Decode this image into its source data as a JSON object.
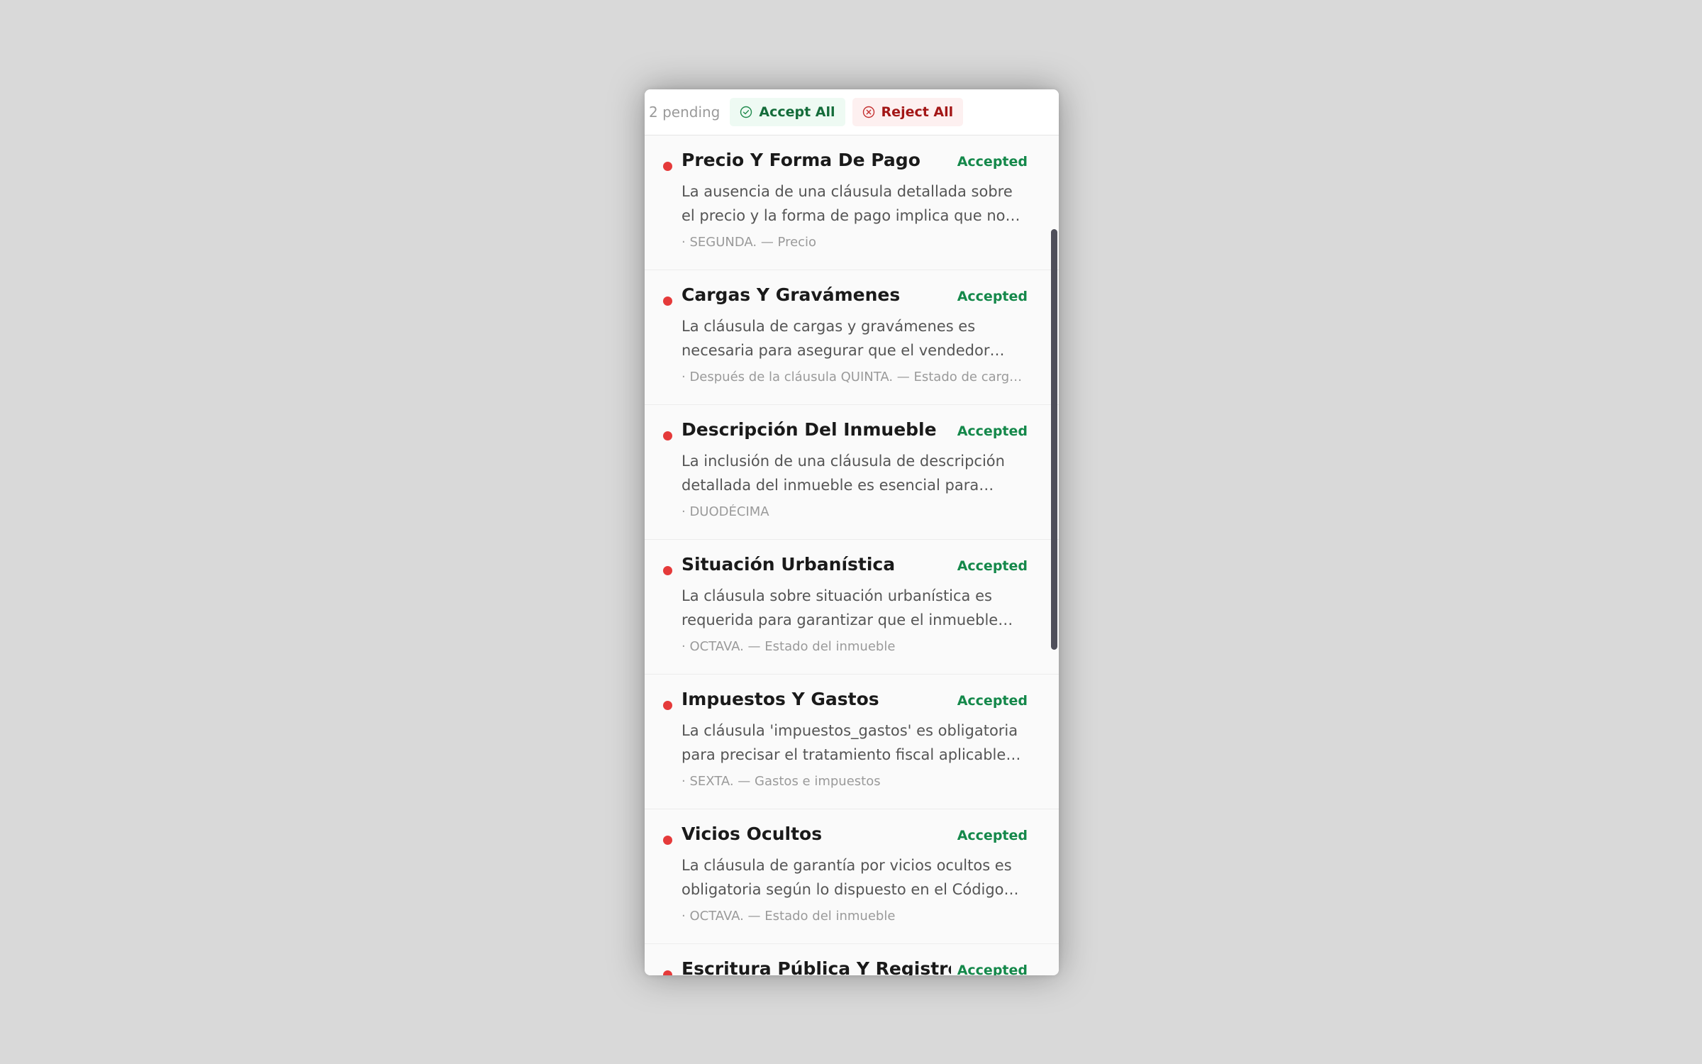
{
  "toolbar": {
    "pending_label": "2 pending",
    "accept_all_label": "Accept All",
    "reject_all_label": "Reject All",
    "accept_icon": "check-circle-icon",
    "reject_icon": "x-circle-icon"
  },
  "colors": {
    "accent_green": "#14884a",
    "accent_red": "#a31616",
    "dot_red": "#e53a3a"
  },
  "items": [
    {
      "title": "Precio Y Forma De Pago",
      "status": "Accepted",
      "description": "La ausencia de una cláusula detallada sobre el precio y la forma de pago implica que no se establecen claramente las condiciones económicas de la operación.",
      "meta": "· SEGUNDA. — Precio"
    },
    {
      "title": "Cargas Y Gravámenes",
      "status": "Accepted",
      "description": "La cláusula de cargas y gravámenes es necesaria para asegurar que el vendedor entrega el inmueble libre de cargas.",
      "meta": "· Después de la cláusula QUINTA. — Estado de cargas y gravámenes"
    },
    {
      "title": "Descripción Del Inmueble",
      "status": "Accepted",
      "description": "La inclusión de una cláusula de descripción detallada del inmueble es esencial para identificar correctamente el objeto de la compraventa.",
      "meta": "· DUODÉCIMA"
    },
    {
      "title": "Situación Urbanística",
      "status": "Accepted",
      "description": "La cláusula sobre situación urbanística es requerida para garantizar que el inmueble cumple con la normativa vigente.",
      "meta": "· OCTAVA. — Estado del inmueble"
    },
    {
      "title": "Impuestos Y Gastos",
      "status": "Accepted",
      "description": "La cláusula 'impuestos_gastos' es obligatoria para precisar el tratamiento fiscal aplicable a la operación.",
      "meta": "· SEXTA. — Gastos e impuestos"
    },
    {
      "title": "Vicios Ocultos",
      "status": "Accepted",
      "description": "La cláusula de garantía por vicios ocultos es obligatoria según lo dispuesto en el Código Civil.",
      "meta": "· OCTAVA. — Estado del inmueble"
    },
    {
      "title": "Escritura Pública Y Registro",
      "status": "Accepted",
      "description": "",
      "meta": ""
    }
  ]
}
